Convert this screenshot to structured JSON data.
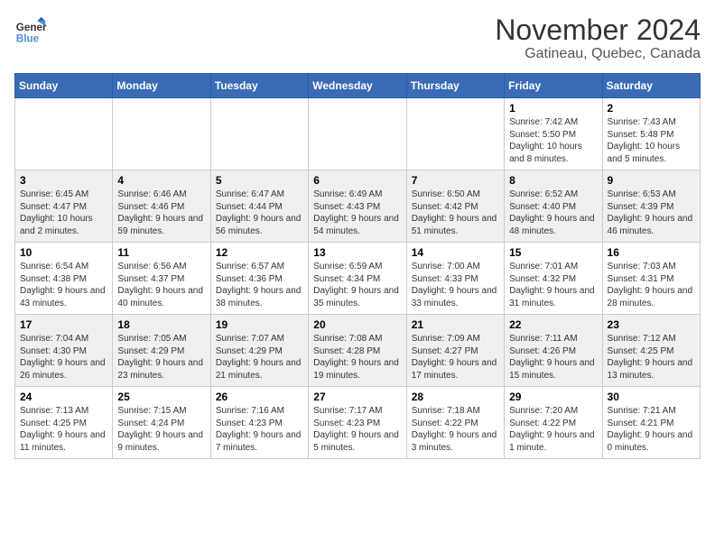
{
  "logo": {
    "line1": "General",
    "line2": "Blue"
  },
  "title": "November 2024",
  "location": "Gatineau, Quebec, Canada",
  "weekdays": [
    "Sunday",
    "Monday",
    "Tuesday",
    "Wednesday",
    "Thursday",
    "Friday",
    "Saturday"
  ],
  "weeks": [
    [
      {
        "day": "",
        "info": ""
      },
      {
        "day": "",
        "info": ""
      },
      {
        "day": "",
        "info": ""
      },
      {
        "day": "",
        "info": ""
      },
      {
        "day": "",
        "info": ""
      },
      {
        "day": "1",
        "info": "Sunrise: 7:42 AM\nSunset: 5:50 PM\nDaylight: 10 hours and 8 minutes."
      },
      {
        "day": "2",
        "info": "Sunrise: 7:43 AM\nSunset: 5:48 PM\nDaylight: 10 hours and 5 minutes."
      }
    ],
    [
      {
        "day": "3",
        "info": "Sunrise: 6:45 AM\nSunset: 4:47 PM\nDaylight: 10 hours and 2 minutes."
      },
      {
        "day": "4",
        "info": "Sunrise: 6:46 AM\nSunset: 4:46 PM\nDaylight: 9 hours and 59 minutes."
      },
      {
        "day": "5",
        "info": "Sunrise: 6:47 AM\nSunset: 4:44 PM\nDaylight: 9 hours and 56 minutes."
      },
      {
        "day": "6",
        "info": "Sunrise: 6:49 AM\nSunset: 4:43 PM\nDaylight: 9 hours and 54 minutes."
      },
      {
        "day": "7",
        "info": "Sunrise: 6:50 AM\nSunset: 4:42 PM\nDaylight: 9 hours and 51 minutes."
      },
      {
        "day": "8",
        "info": "Sunrise: 6:52 AM\nSunset: 4:40 PM\nDaylight: 9 hours and 48 minutes."
      },
      {
        "day": "9",
        "info": "Sunrise: 6:53 AM\nSunset: 4:39 PM\nDaylight: 9 hours and 46 minutes."
      }
    ],
    [
      {
        "day": "10",
        "info": "Sunrise: 6:54 AM\nSunset: 4:38 PM\nDaylight: 9 hours and 43 minutes."
      },
      {
        "day": "11",
        "info": "Sunrise: 6:56 AM\nSunset: 4:37 PM\nDaylight: 9 hours and 40 minutes."
      },
      {
        "day": "12",
        "info": "Sunrise: 6:57 AM\nSunset: 4:36 PM\nDaylight: 9 hours and 38 minutes."
      },
      {
        "day": "13",
        "info": "Sunrise: 6:59 AM\nSunset: 4:34 PM\nDaylight: 9 hours and 35 minutes."
      },
      {
        "day": "14",
        "info": "Sunrise: 7:00 AM\nSunset: 4:33 PM\nDaylight: 9 hours and 33 minutes."
      },
      {
        "day": "15",
        "info": "Sunrise: 7:01 AM\nSunset: 4:32 PM\nDaylight: 9 hours and 31 minutes."
      },
      {
        "day": "16",
        "info": "Sunrise: 7:03 AM\nSunset: 4:31 PM\nDaylight: 9 hours and 28 minutes."
      }
    ],
    [
      {
        "day": "17",
        "info": "Sunrise: 7:04 AM\nSunset: 4:30 PM\nDaylight: 9 hours and 26 minutes."
      },
      {
        "day": "18",
        "info": "Sunrise: 7:05 AM\nSunset: 4:29 PM\nDaylight: 9 hours and 23 minutes."
      },
      {
        "day": "19",
        "info": "Sunrise: 7:07 AM\nSunset: 4:29 PM\nDaylight: 9 hours and 21 minutes."
      },
      {
        "day": "20",
        "info": "Sunrise: 7:08 AM\nSunset: 4:28 PM\nDaylight: 9 hours and 19 minutes."
      },
      {
        "day": "21",
        "info": "Sunrise: 7:09 AM\nSunset: 4:27 PM\nDaylight: 9 hours and 17 minutes."
      },
      {
        "day": "22",
        "info": "Sunrise: 7:11 AM\nSunset: 4:26 PM\nDaylight: 9 hours and 15 minutes."
      },
      {
        "day": "23",
        "info": "Sunrise: 7:12 AM\nSunset: 4:25 PM\nDaylight: 9 hours and 13 minutes."
      }
    ],
    [
      {
        "day": "24",
        "info": "Sunrise: 7:13 AM\nSunset: 4:25 PM\nDaylight: 9 hours and 11 minutes."
      },
      {
        "day": "25",
        "info": "Sunrise: 7:15 AM\nSunset: 4:24 PM\nDaylight: 9 hours and 9 minutes."
      },
      {
        "day": "26",
        "info": "Sunrise: 7:16 AM\nSunset: 4:23 PM\nDaylight: 9 hours and 7 minutes."
      },
      {
        "day": "27",
        "info": "Sunrise: 7:17 AM\nSunset: 4:23 PM\nDaylight: 9 hours and 5 minutes."
      },
      {
        "day": "28",
        "info": "Sunrise: 7:18 AM\nSunset: 4:22 PM\nDaylight: 9 hours and 3 minutes."
      },
      {
        "day": "29",
        "info": "Sunrise: 7:20 AM\nSunset: 4:22 PM\nDaylight: 9 hours and 1 minute."
      },
      {
        "day": "30",
        "info": "Sunrise: 7:21 AM\nSunset: 4:21 PM\nDaylight: 9 hours and 0 minutes."
      }
    ]
  ]
}
